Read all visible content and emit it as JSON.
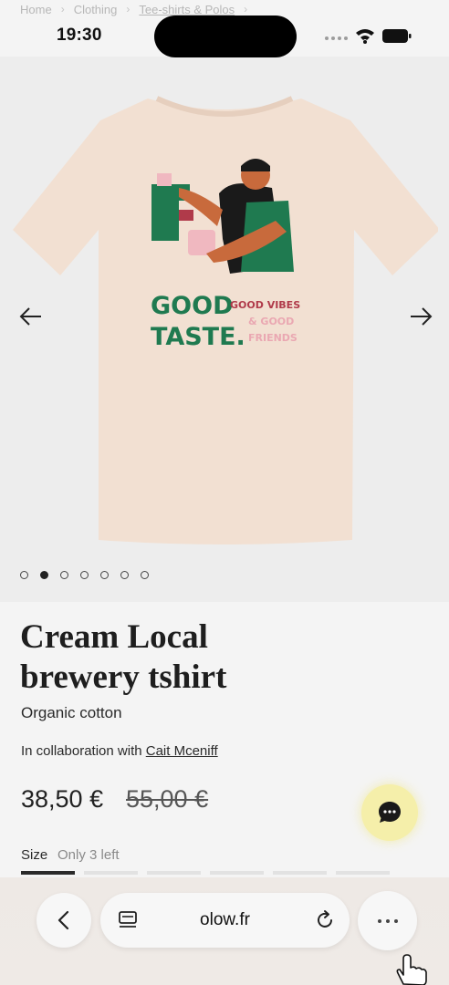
{
  "breadcrumb": {
    "items": [
      "Home",
      "Clothing",
      "Tee-shirts & Polos"
    ]
  },
  "status_bar": {
    "time": "19:30"
  },
  "gallery": {
    "image_count": 7,
    "active_index": 1
  },
  "product": {
    "title_line1": "Cream Local",
    "title_line2": "brewery tshirt",
    "material": "Organic cotton",
    "collab_prefix": "In collaboration with",
    "collab_artist": "Cait Mceniff",
    "price": "38,50 €",
    "old_price": "55,00 €",
    "size_label": "Size",
    "stock_text": "Only 3 left"
  },
  "shirt_print": {
    "line1": "GOOD",
    "line2": "TASTE.",
    "side1": "GOOD VIBES",
    "side2": "& GOOD",
    "side3": "FRIENDS"
  },
  "browser": {
    "url": "olow.fr"
  },
  "colors": {
    "shirt": "#f2e0d2",
    "accent_green": "#1f7a50",
    "chat_bubble": "#f5efaa"
  }
}
